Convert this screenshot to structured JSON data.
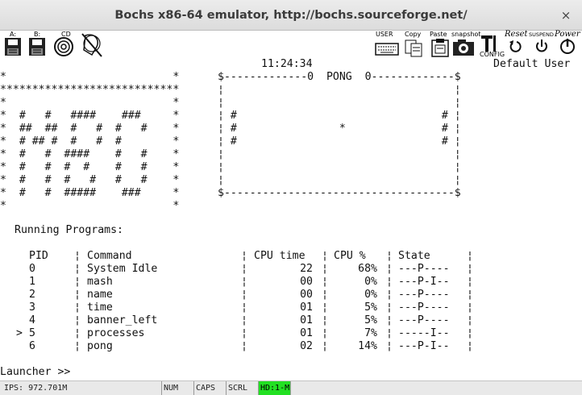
{
  "window": {
    "title": "Bochs x86-64 emulator, http://bochs.sourceforge.net/",
    "close_glyph": "×"
  },
  "toolbar": {
    "floppy_a": "A:",
    "floppy_b": "B:",
    "cdrom": "CD",
    "user": "USER",
    "copy": "Copy",
    "paste": "Paste",
    "snapshot": "snapshot",
    "config": "CONFIG",
    "reset": "Reset",
    "suspend": "SUSPEND",
    "power": "Power"
  },
  "screen": {
    "clock": "11:24:34",
    "user": "Default User",
    "banner_lines": [
      "*                          *",
      "****************************",
      "*                          *",
      "*  #   #   ####    ###     *",
      "*  ##  ##  #   #  #   #    *",
      "*  # ## #  #   #  #        *",
      "*  #   #  ####    #   #    *",
      "*  #   #  #  #    #   #    *",
      "*  #   #  #   #   #   #    *",
      "*  #   #  #####    ###     *",
      "*                          *"
    ],
    "pong_lines": [
      "$-------------0  PONG  0-------------$",
      "¦                                    ¦",
      "¦                                    ¦",
      "¦ #                                # ¦",
      "¦ #                *               # ¦",
      "¦ #                                # ¦",
      "¦                                    ¦",
      "¦                                    ¦",
      "¦                                    ¦",
      "$------------------------------------$"
    ],
    "running_title": "Running Programs:",
    "table_headers": {
      "pid": "PID",
      "command": "Command",
      "cpu_time": "CPU time",
      "cpu_pct": "CPU %",
      "state": "State"
    },
    "processes": [
      {
        "marker": "",
        "pid": "0",
        "command": "System Idle",
        "cpu_time": "22",
        "cpu_pct": "68%",
        "state": "---P----"
      },
      {
        "marker": "",
        "pid": "1",
        "command": "mash",
        "cpu_time": "00",
        "cpu_pct": "0%",
        "state": "---P-I--"
      },
      {
        "marker": "",
        "pid": "2",
        "command": "name",
        "cpu_time": "00",
        "cpu_pct": "0%",
        "state": "---P----"
      },
      {
        "marker": "",
        "pid": "3",
        "command": "time",
        "cpu_time": "01",
        "cpu_pct": "5%",
        "state": "---P----"
      },
      {
        "marker": "",
        "pid": "4",
        "command": "banner_left",
        "cpu_time": "01",
        "cpu_pct": "5%",
        "state": "---P----"
      },
      {
        "marker": ">",
        "pid": "5",
        "command": "processes",
        "cpu_time": "01",
        "cpu_pct": "7%",
        "state": "-----I--"
      },
      {
        "marker": "",
        "pid": "6",
        "command": "pong",
        "cpu_time": "02",
        "cpu_pct": "14%",
        "state": "---P-I--"
      }
    ],
    "separator": "¦",
    "prompt": "Launcher >>"
  },
  "statusbar": {
    "ips": "IPS: 972.701M",
    "num": "NUM",
    "caps": "CAPS",
    "scrl": "SCRL",
    "hd": "HD:1-M",
    "hd_color": "#22e022"
  },
  "colors": {
    "screen_bg": "#ffffff",
    "screen_fg": "#111111",
    "titlebar": "#e3e3e3"
  }
}
